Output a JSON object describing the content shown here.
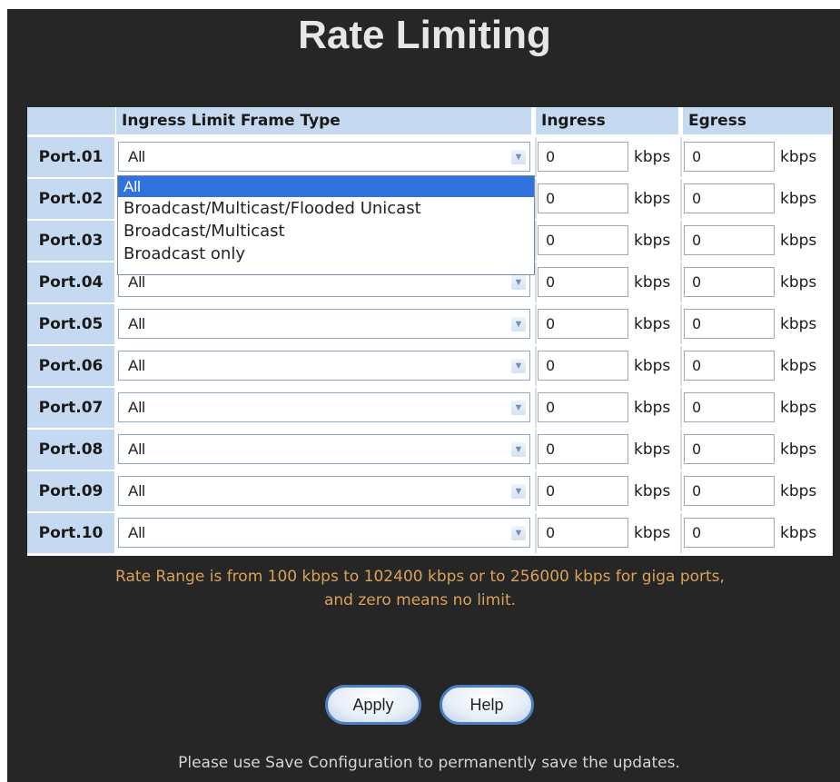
{
  "page": {
    "title": "Rate Limiting"
  },
  "table": {
    "headers": {
      "frame_type": "Ingress Limit Frame Type",
      "ingress": "Ingress",
      "egress": "Egress"
    },
    "unit": "kbps",
    "rows": [
      {
        "port": "Port.01",
        "frame_type": "All",
        "ingress": "0",
        "egress": "0"
      },
      {
        "port": "Port.02",
        "frame_type": "All",
        "ingress": "0",
        "egress": "0"
      },
      {
        "port": "Port.03",
        "frame_type": "All",
        "ingress": "0",
        "egress": "0"
      },
      {
        "port": "Port.04",
        "frame_type": "All",
        "ingress": "0",
        "egress": "0"
      },
      {
        "port": "Port.05",
        "frame_type": "All",
        "ingress": "0",
        "egress": "0"
      },
      {
        "port": "Port.06",
        "frame_type": "All",
        "ingress": "0",
        "egress": "0"
      },
      {
        "port": "Port.07",
        "frame_type": "All",
        "ingress": "0",
        "egress": "0"
      },
      {
        "port": "Port.08",
        "frame_type": "All",
        "ingress": "0",
        "egress": "0"
      },
      {
        "port": "Port.09",
        "frame_type": "All",
        "ingress": "0",
        "egress": "0"
      },
      {
        "port": "Port.10",
        "frame_type": "All",
        "ingress": "0",
        "egress": "0"
      }
    ]
  },
  "dropdown": {
    "options": [
      "All",
      "Broadcast/Multicast/Flooded Unicast",
      "Broadcast/Multicast",
      "Broadcast only"
    ],
    "selected": "All"
  },
  "note": {
    "line1": "Rate Range is from 100 kbps to 102400 kbps or to 256000 kbps for giga ports,",
    "line2": "and zero means no limit."
  },
  "buttons": {
    "apply": "Apply",
    "help": "Help"
  },
  "footer": "Please use Save Configuration to permanently save the updates.",
  "colors": {
    "header_bg": "#c5d9f1",
    "note_text": "#d9a25b",
    "selected_option": "#3173de",
    "background": "#262626"
  },
  "icons": {
    "select_arrow": "chevron-down-icon"
  }
}
